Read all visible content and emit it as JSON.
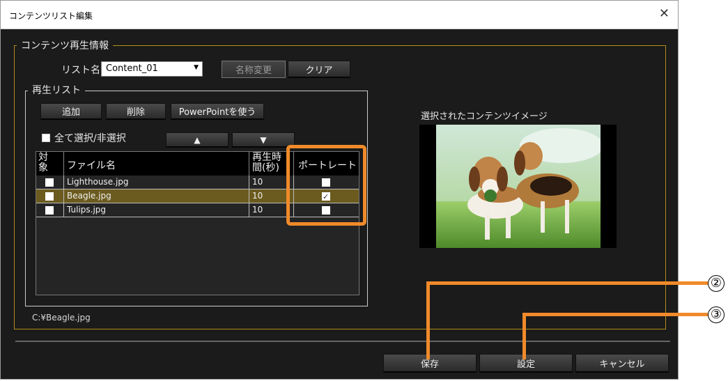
{
  "window": {
    "title": "コンテンツリスト編集",
    "close_glyph": "✕"
  },
  "content_info": {
    "legend": "コンテンツ再生情報",
    "list_name_label": "リスト名",
    "list_name_value": "Content_01",
    "rename_button": "名称変更",
    "clear_button": "クリア"
  },
  "playlist": {
    "legend": "再生リスト",
    "add_button": "追加",
    "delete_button": "削除",
    "powerpoint_button": "PowerPointを使う",
    "select_all_label": "全て選択/非選択",
    "up_button": "▲",
    "down_button": "▼",
    "columns": {
      "target": "対象",
      "filename": "ファイル名",
      "duration": "再生時間(秒)",
      "portrait": "ポートレート"
    },
    "rows": [
      {
        "selected": false,
        "filename": "Lighthouse.jpg",
        "duration": "10",
        "portrait": false
      },
      {
        "selected": false,
        "filename": "Beagle.jpg",
        "duration": "10",
        "portrait": true
      },
      {
        "selected": false,
        "filename": "Tulips.jpg",
        "duration": "10",
        "portrait": false
      }
    ]
  },
  "preview": {
    "label": "選択されたコンテンツイメージ"
  },
  "file_path": "C:¥Beagle.jpg",
  "footer": {
    "save_button": "保存",
    "set_button": "設定",
    "cancel_button": "キャンセル"
  },
  "callouts": [
    {
      "label": "②"
    },
    {
      "label": "③"
    }
  ],
  "colors": {
    "highlight_orange": "#f08a2a",
    "selected_row": "#6b5b1e",
    "group_border": "#b38f1a"
  }
}
